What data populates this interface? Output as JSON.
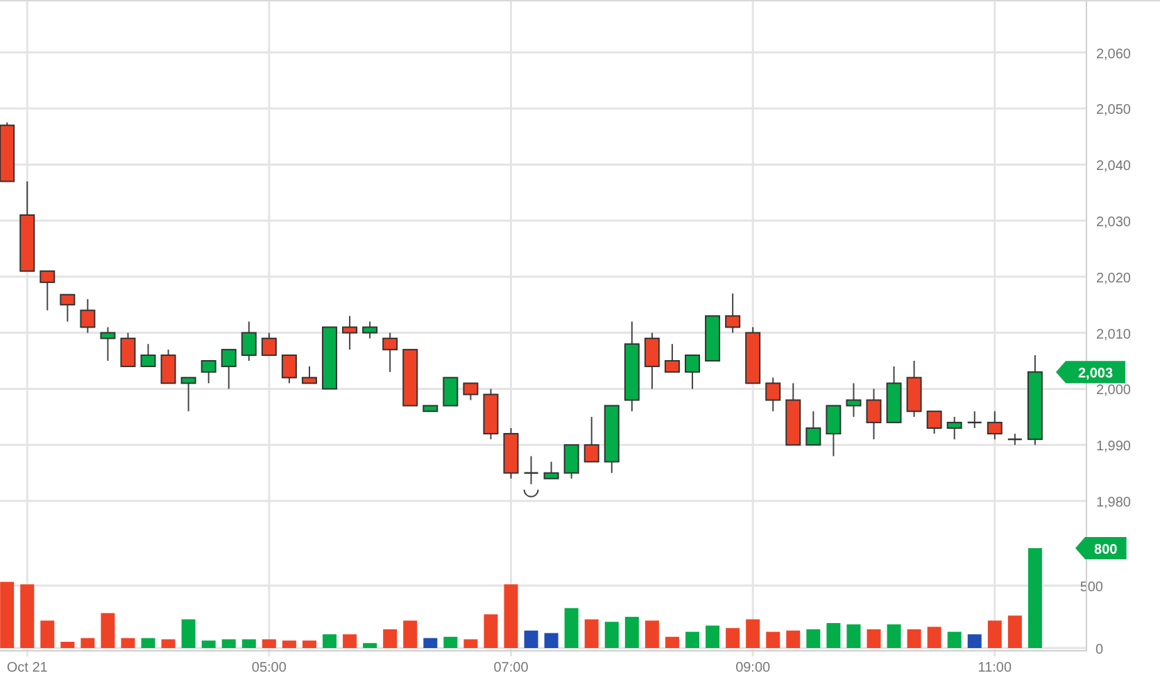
{
  "price_chart": {
    "chart_data": {
      "type": "candlestick",
      "grid": true,
      "categories": [
        null,
        null,
        null,
        null,
        null,
        null,
        null,
        null,
        null,
        null,
        null,
        null,
        null,
        null,
        null,
        null,
        null,
        null,
        null,
        null,
        null,
        null,
        null,
        null,
        null,
        null,
        null,
        null,
        null,
        null,
        null,
        null,
        null,
        null,
        null,
        null,
        null,
        null,
        null,
        null,
        null,
        null,
        null,
        null,
        null,
        null,
        null,
        null,
        null,
        null,
        null,
        null
      ],
      "ylim": [
        1975.8,
        2069.1
      ],
      "yticks": [
        {
          "value": 1980,
          "label": "1,980"
        },
        {
          "value": 1990,
          "label": "1,990"
        },
        {
          "value": 2000,
          "label": "2,000"
        },
        {
          "value": 2010,
          "label": "2,010"
        },
        {
          "value": 2020,
          "label": "2,020"
        },
        {
          "value": 2030,
          "label": "2,030"
        },
        {
          "value": 2040,
          "label": "2,040"
        },
        {
          "value": 2050,
          "label": "2,050"
        },
        {
          "value": 2060,
          "label": "2,060"
        }
      ],
      "ohlc": [
        [
          2047,
          2047.5,
          2037,
          2037
        ],
        [
          2031,
          2037,
          2021,
          2021
        ],
        [
          2021,
          2021,
          2014,
          2019
        ],
        [
          2016.8,
          2016.8,
          2012,
          2015
        ],
        [
          2014,
          2016,
          2010,
          2011
        ],
        [
          2009,
          2011,
          2005,
          2010
        ],
        [
          2009,
          2010,
          2004,
          2004
        ],
        [
          2004,
          2008,
          2004,
          2006
        ],
        [
          2006,
          2007,
          2001,
          2001
        ],
        [
          2001,
          2002,
          1996,
          2002
        ],
        [
          2003,
          2005,
          2001,
          2005
        ],
        [
          2004,
          2007,
          2000,
          2007
        ],
        [
          2006,
          2012,
          2005,
          2010
        ],
        [
          2009,
          2010,
          2006,
          2006
        ],
        [
          2006,
          2006,
          2001,
          2002
        ],
        [
          2002,
          2004,
          2001,
          2001
        ],
        [
          2000,
          2011,
          2000,
          2011
        ],
        [
          2011,
          2013,
          2007,
          2010
        ],
        [
          2010,
          2012,
          2009,
          2011
        ],
        [
          2009,
          2010,
          2003,
          2007
        ],
        [
          2007,
          2007,
          1997,
          1997
        ],
        [
          1996,
          1997,
          1996,
          1997
        ],
        [
          1997,
          2002,
          1997,
          2002
        ],
        [
          2001,
          2001,
          1998,
          1999
        ],
        [
          1999,
          2000,
          1991,
          1992
        ],
        [
          1992,
          1993,
          1984,
          1985
        ],
        [
          1985,
          1988,
          1983,
          1985
        ],
        [
          1984,
          1987,
          1984,
          1985
        ],
        [
          1985,
          1990,
          1984,
          1990
        ],
        [
          1990,
          1995,
          1987,
          1987
        ],
        [
          1987,
          1997,
          1985,
          1997
        ],
        [
          1998,
          2012,
          1996,
          2008
        ],
        [
          2009,
          2010,
          2000,
          2004
        ],
        [
          2005,
          2008,
          2003,
          2003
        ],
        [
          2003,
          2006,
          2000,
          2006
        ],
        [
          2005,
          2013,
          2005,
          2013
        ],
        [
          2013,
          2017,
          2010,
          2011
        ],
        [
          2010,
          2011,
          2001,
          2001
        ],
        [
          2001,
          2002,
          1996,
          1998
        ],
        [
          1998,
          2001,
          1990,
          1990
        ],
        [
          1990,
          1996,
          1990,
          1993
        ],
        [
          1992,
          1997,
          1988,
          1997
        ],
        [
          1997,
          2001,
          1995,
          1998
        ],
        [
          1998,
          2000,
          1991,
          1994
        ],
        [
          1994,
          2004,
          1994,
          2001
        ],
        [
          2002,
          2005,
          1995,
          1996
        ],
        [
          1996,
          1996,
          1992,
          1993
        ],
        [
          1993,
          1995,
          1991,
          1994
        ],
        [
          1994,
          1996,
          1993,
          1994
        ],
        [
          1994,
          1996,
          1991,
          1992
        ],
        [
          1991,
          1992,
          1990,
          1991
        ],
        [
          1991,
          2006,
          1990,
          2003
        ]
      ],
      "annotations": [
        "2,003"
      ]
    }
  },
  "volume_chart": {
    "chart_data": {
      "type": "bar",
      "grid": true,
      "categories": [
        null,
        "Oct 21",
        null,
        null,
        null,
        null,
        null,
        null,
        null,
        null,
        null,
        null,
        null,
        "05:00",
        null,
        null,
        null,
        null,
        null,
        null,
        null,
        null,
        null,
        null,
        null,
        "07:00",
        null,
        null,
        null,
        null,
        null,
        null,
        null,
        null,
        null,
        null,
        null,
        "09:00",
        null,
        null,
        null,
        null,
        null,
        null,
        null,
        null,
        null,
        null,
        null,
        "11:00",
        null,
        null
      ],
      "ylim": [
        0,
        989
      ],
      "yticks": [
        {
          "value": 0,
          "label": "0"
        },
        {
          "value": 500,
          "label": "500"
        }
      ],
      "series": [
        {
          "color": "#ef4327",
          "values": [
            530,
            510,
            220,
            50,
            80,
            280,
            80,
            null,
            70,
            null,
            null,
            null,
            null,
            70,
            60,
            60,
            null,
            110,
            null,
            150,
            220,
            null,
            null,
            70,
            270,
            510,
            null,
            null,
            null,
            230,
            null,
            null,
            220,
            90,
            null,
            null,
            160,
            230,
            130,
            140,
            null,
            null,
            null,
            150,
            null,
            150,
            170,
            null,
            null,
            220,
            260,
            null
          ]
        },
        {
          "color": "#03ad4a",
          "values": [
            null,
            null,
            null,
            null,
            null,
            null,
            null,
            80,
            null,
            230,
            60,
            70,
            70,
            null,
            null,
            null,
            110,
            null,
            40,
            null,
            null,
            null,
            90,
            null,
            null,
            null,
            null,
            null,
            320,
            null,
            210,
            250,
            null,
            null,
            130,
            180,
            null,
            null,
            null,
            null,
            150,
            200,
            190,
            null,
            190,
            null,
            null,
            130,
            null,
            null,
            null,
            800
          ]
        },
        {
          "color": "#1f4db5",
          "values": [
            null,
            null,
            null,
            null,
            null,
            null,
            null,
            null,
            null,
            null,
            null,
            null,
            null,
            null,
            null,
            null,
            null,
            null,
            null,
            null,
            null,
            80,
            null,
            null,
            null,
            null,
            140,
            120,
            null,
            null,
            null,
            null,
            null,
            null,
            null,
            null,
            null,
            null,
            null,
            null,
            null,
            null,
            null,
            null,
            null,
            null,
            null,
            null,
            110,
            null,
            null,
            null
          ]
        }
      ],
      "annotations": [
        "800"
      ]
    }
  }
}
